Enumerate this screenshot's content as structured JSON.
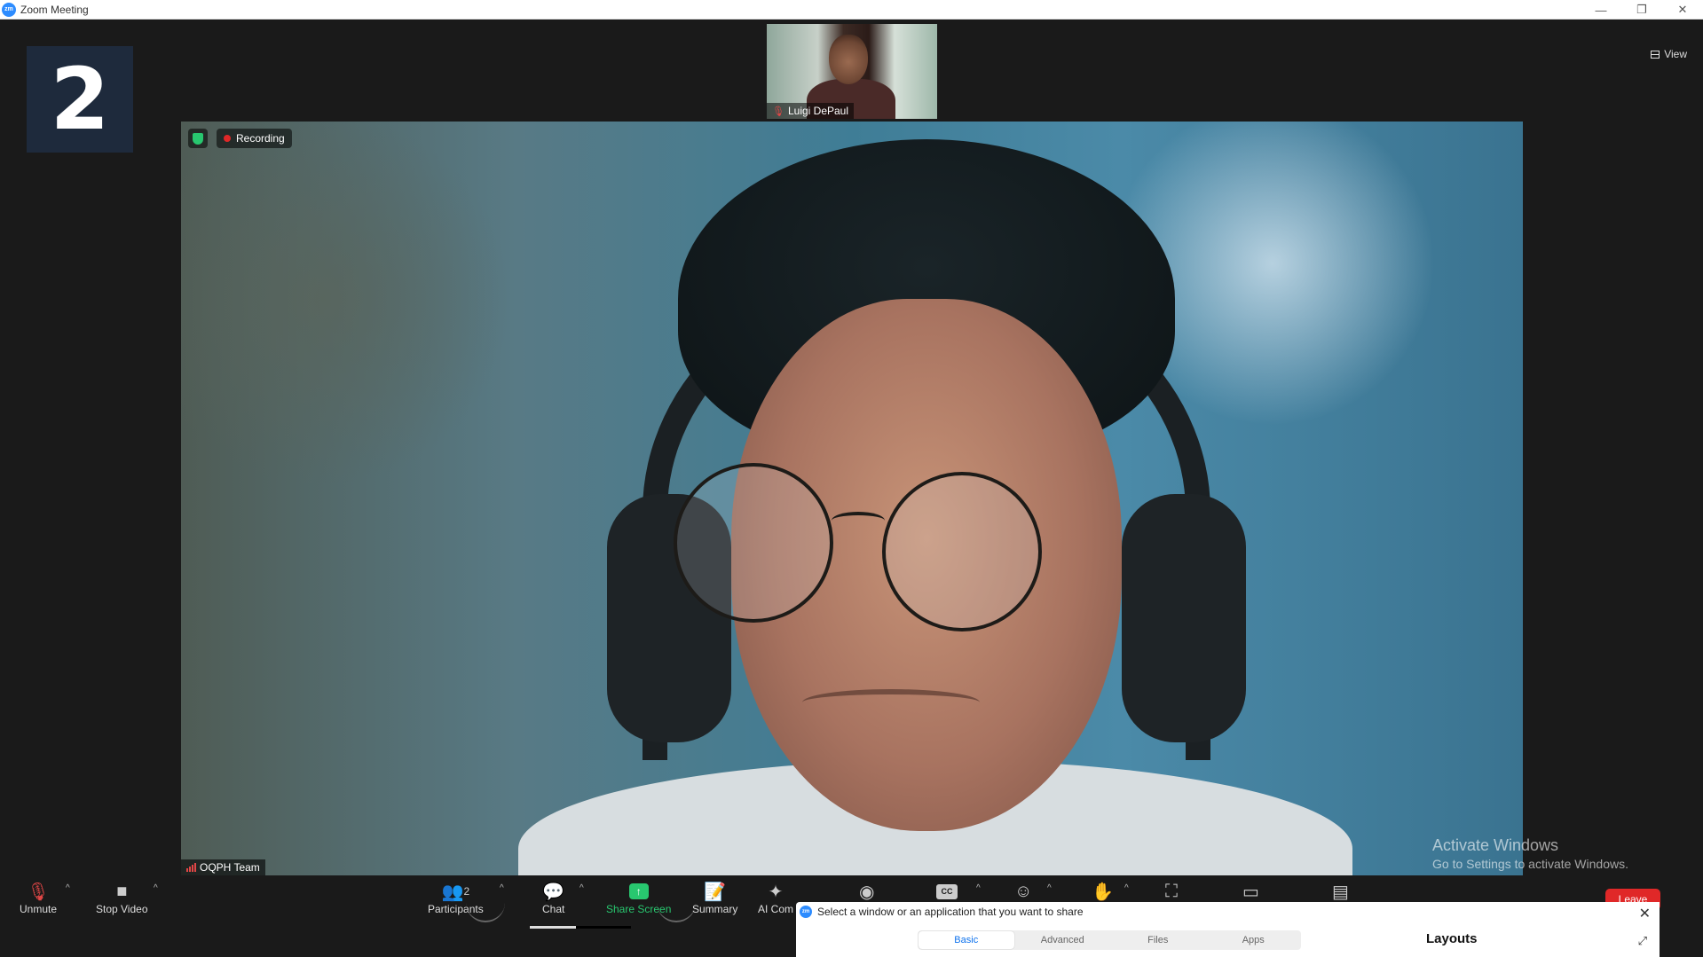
{
  "window": {
    "title": "Zoom Meeting",
    "minimize": "—",
    "restore": "❐",
    "close": "✕"
  },
  "counter": {
    "value": "2"
  },
  "view": {
    "label": "View"
  },
  "thumbnail": {
    "name": "Luigi DePaul"
  },
  "main_video": {
    "recording_label": "Recording",
    "name": "OQPH Team"
  },
  "watermark": {
    "title": "Activate Windows",
    "subtitle": "Go to Settings to activate Windows."
  },
  "toolbar": {
    "unmute": "Unmute",
    "stop_video": "Stop Video",
    "participants": "Participants",
    "participants_count": "2",
    "chat": "Chat",
    "share_screen": "Share Screen",
    "summary": "Summary",
    "ai_companion": "AI Com",
    "leave": "Leave"
  },
  "share_popup": {
    "title": "Select a window or an application that you want to share",
    "tabs": [
      "Basic",
      "Advanced",
      "Files",
      "Apps"
    ],
    "active_tab": "Basic",
    "layouts": "Layouts"
  },
  "colors": {
    "accent": "#2d8cff",
    "share_green": "#28c76f",
    "leave_red": "#e02828",
    "recording_red": "#e02828"
  }
}
